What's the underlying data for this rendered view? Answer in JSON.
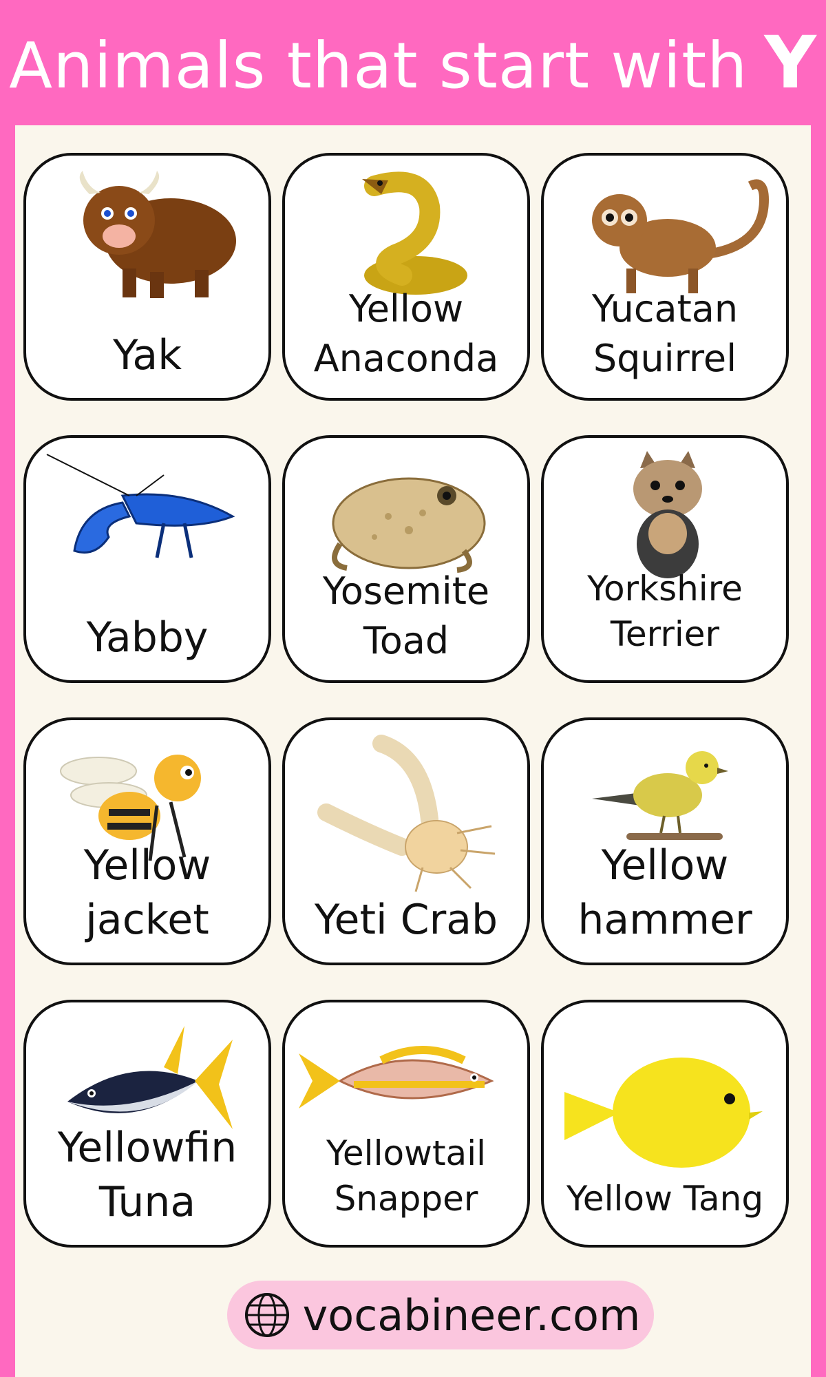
{
  "header": {
    "title": "Animals that start with",
    "letter": "Y"
  },
  "cards": [
    {
      "line1": "Yak",
      "line2": "",
      "icon": "yak-icon"
    },
    {
      "line1": "Yellow",
      "line2": "Anaconda",
      "icon": "anaconda-icon"
    },
    {
      "line1": "Yucatan",
      "line2": "Squirrel",
      "icon": "monkey-icon"
    },
    {
      "line1": "Yabby",
      "line2": "",
      "icon": "crayfish-icon"
    },
    {
      "line1": "Yosemite",
      "line2": "Toad",
      "icon": "toad-icon"
    },
    {
      "line1": "Yorkshire",
      "line2": "Terrier",
      "icon": "dog-icon"
    },
    {
      "line1": "Yellow",
      "line2": "jacket",
      "icon": "wasp-icon"
    },
    {
      "line1": "Yeti Crab",
      "line2": "",
      "icon": "crab-icon"
    },
    {
      "line1": "Yellow",
      "line2": "hammer",
      "icon": "bird-icon"
    },
    {
      "line1": "Yellowfin",
      "line2": "Tuna",
      "icon": "tuna-icon"
    },
    {
      "line1": "Yellowtail",
      "line2": "Snapper",
      "icon": "snapper-icon"
    },
    {
      "line1": "Yellow Tang",
      "line2": "",
      "icon": "tang-icon"
    }
  ],
  "footer": {
    "url": "vocabineer.com",
    "icon": "globe-icon"
  },
  "colors": {
    "background": "#ff69c0",
    "panel": "#faf6ec",
    "card": "#ffffff",
    "footer_pill": "#fbc6de"
  }
}
